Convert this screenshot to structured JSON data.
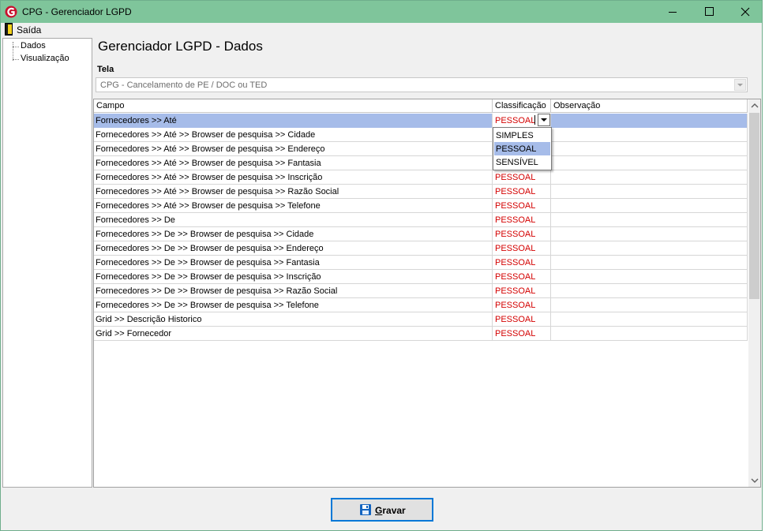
{
  "window": {
    "title": "CPG - Gerenciador LGPD"
  },
  "menu": {
    "exit_label": "Saída"
  },
  "nav_tree": {
    "items": [
      {
        "label": "Dados"
      },
      {
        "label": "Visualização"
      }
    ]
  },
  "page": {
    "title": "Gerenciador LGPD - Dados"
  },
  "screen_field": {
    "label": "Tela",
    "value": "CPG - Cancelamento de PE / DOC ou TED"
  },
  "grid": {
    "headers": {
      "campo": "Campo",
      "classificacao": "Classificação",
      "observacao": "Observação"
    },
    "rows": [
      {
        "campo": "Fornecedores >> Até",
        "classificacao": "PESSOAL",
        "observacao": ""
      },
      {
        "campo": "Fornecedores >> Até >> Browser de pesquisa >> Cidade",
        "classificacao": "",
        "observacao": ""
      },
      {
        "campo": "Fornecedores >> Até >> Browser de pesquisa >> Endereço",
        "classificacao": "",
        "observacao": ""
      },
      {
        "campo": "Fornecedores >> Até >> Browser de pesquisa >> Fantasia",
        "classificacao": "",
        "observacao": ""
      },
      {
        "campo": "Fornecedores >> Até >> Browser de pesquisa >> Inscrição",
        "classificacao": "PESSOAL",
        "observacao": ""
      },
      {
        "campo": "Fornecedores >> Até >> Browser de pesquisa >> Razão Social",
        "classificacao": "PESSOAL",
        "observacao": ""
      },
      {
        "campo": "Fornecedores >> Até >> Browser de pesquisa >> Telefone",
        "classificacao": "PESSOAL",
        "observacao": ""
      },
      {
        "campo": "Fornecedores >> De",
        "classificacao": "PESSOAL",
        "observacao": ""
      },
      {
        "campo": "Fornecedores >> De >> Browser de pesquisa >> Cidade",
        "classificacao": "PESSOAL",
        "observacao": ""
      },
      {
        "campo": "Fornecedores >> De >> Browser de pesquisa >> Endereço",
        "classificacao": "PESSOAL",
        "observacao": ""
      },
      {
        "campo": "Fornecedores >> De >> Browser de pesquisa >> Fantasia",
        "classificacao": "PESSOAL",
        "observacao": ""
      },
      {
        "campo": "Fornecedores >> De >> Browser de pesquisa >> Inscrição",
        "classificacao": "PESSOAL",
        "observacao": ""
      },
      {
        "campo": "Fornecedores >> De >> Browser de pesquisa >> Razão Social",
        "classificacao": "PESSOAL",
        "observacao": ""
      },
      {
        "campo": "Fornecedores >> De >> Browser de pesquisa >> Telefone",
        "classificacao": "PESSOAL",
        "observacao": ""
      },
      {
        "campo": "Grid >> Descrição Historico",
        "classificacao": "PESSOAL",
        "observacao": ""
      },
      {
        "campo": "Grid >> Fornecedor",
        "classificacao": "PESSOAL",
        "observacao": ""
      }
    ]
  },
  "classification_dropdown": {
    "options": [
      "SIMPLES",
      "PESSOAL",
      "SENSÍVEL"
    ],
    "highlighted": "PESSOAL"
  },
  "save_button": {
    "label_underlined": "G",
    "label_rest": "ravar"
  },
  "colors": {
    "titlebar": "#7fc59b",
    "selection": "#a6bce9",
    "classification_text": "#d40000",
    "save_icon": "#1565c0"
  }
}
